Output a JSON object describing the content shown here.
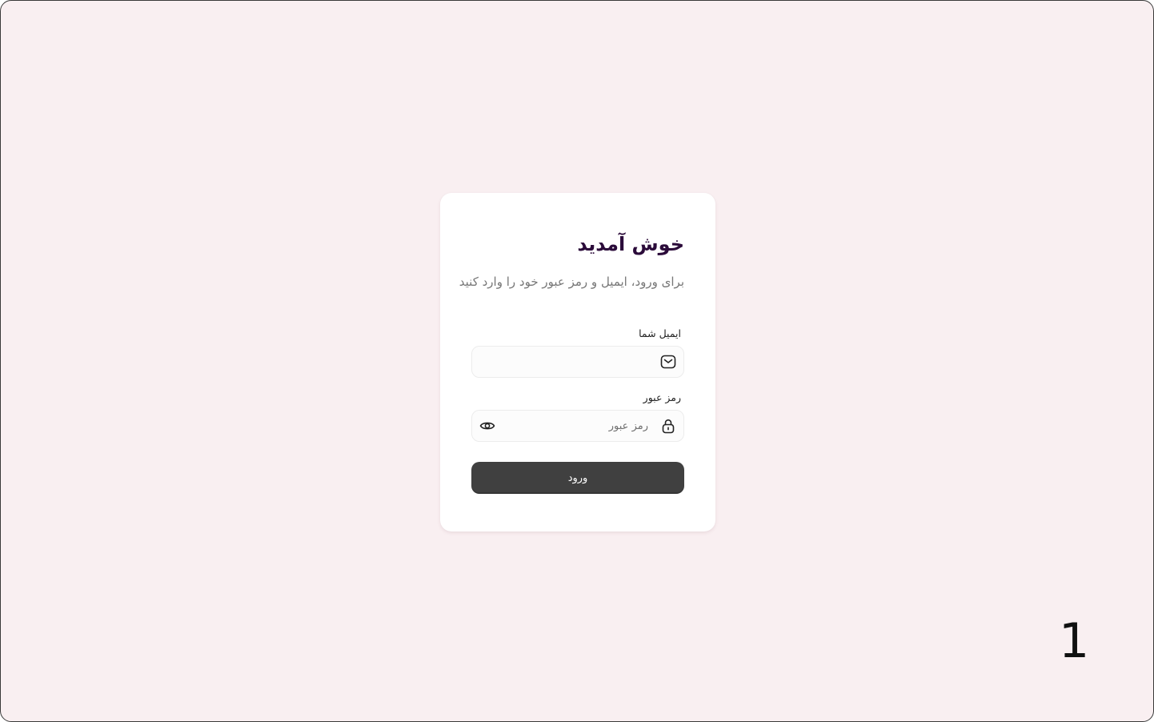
{
  "login": {
    "title": "خوش آمدید",
    "subtitle": "برای ورود، ایمیل و رمز عبور خود را وارد کنید",
    "email": {
      "label": "ایمیل شما",
      "value": "",
      "placeholder": "",
      "icon": "mail-icon"
    },
    "password": {
      "label": "رمز عبور",
      "value": "",
      "placeholder": "رمز عبور",
      "icon": "lock-icon",
      "toggle_icon": "eye-icon"
    },
    "submit_label": "ورود"
  },
  "page_number": "1",
  "colors": {
    "background": "#f9eff1",
    "card": "#ffffff",
    "title": "#2b0b3a",
    "button": "#404040"
  }
}
